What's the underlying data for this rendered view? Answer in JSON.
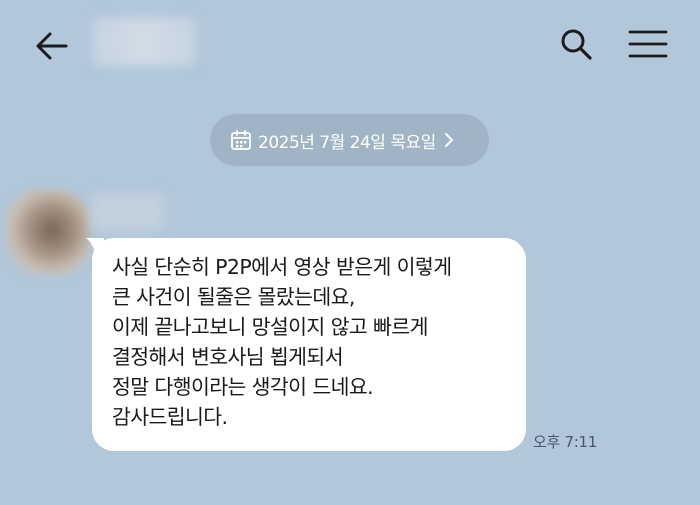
{
  "header": {
    "back_icon": "arrow-left-icon",
    "title": "",
    "search_icon": "search-icon",
    "menu_icon": "hamburger-menu-icon"
  },
  "date_divider": {
    "icon": "calendar-icon",
    "text": "2025년 7월 24일 목요일",
    "chevron_icon": "chevron-right-icon"
  },
  "message": {
    "sender_name": "",
    "lines": [
      "사실 단순히 P2P에서 영상 받은게 이렇게",
      "큰 사건이 될줄은 몰랐는데요,",
      "이제 끝나고보니 망설이지 않고 빠르게",
      "결정해서 변호사님 뵙게되서",
      "정말 다행이라는 생각이 드네요.",
      "감사드립니다."
    ],
    "timestamp": "오후 7:11"
  },
  "colors": {
    "background": "#b2c7da",
    "date_pill": "#a0b4c6",
    "bubble": "#ffffff",
    "icon": "#1c1c1c"
  }
}
